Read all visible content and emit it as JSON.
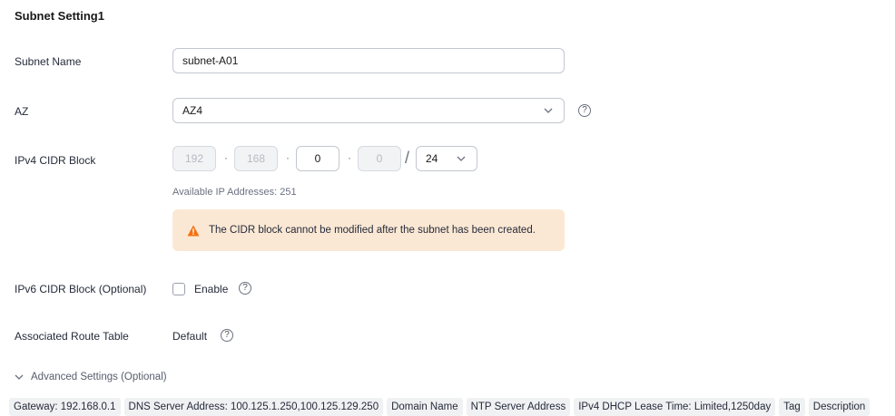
{
  "section": {
    "title": "Subnet Setting1"
  },
  "subnet_name": {
    "label": "Subnet Name",
    "value": "subnet-A01"
  },
  "az": {
    "label": "AZ",
    "value": "AZ4"
  },
  "ipv4": {
    "label": "IPv4 CIDR Block",
    "octets": [
      "192",
      "168",
      "0",
      "0"
    ],
    "mask": "24",
    "available": "Available IP Addresses: 251",
    "warning": "The CIDR block cannot be modified after the subnet has been created."
  },
  "ipv6": {
    "label": "IPv6 CIDR Block (Optional)",
    "enable_label": "Enable"
  },
  "route_table": {
    "label": "Associated Route Table",
    "value": "Default"
  },
  "advanced": {
    "label": "Advanced Settings (Optional)",
    "tags": [
      "Gateway: 192.168.0.1",
      "DNS Server Address: 100.125.1.250,100.125.129.250",
      "Domain Name",
      "NTP Server Address",
      "IPv4 DHCP Lease Time: Limited,1250day",
      "Tag",
      "Description"
    ]
  },
  "colors": {
    "warning_bg": "#fbe8d4",
    "warning_icon": "#f66f0f",
    "disabled_bg": "#f2f3f5"
  },
  "icons": {
    "help": "question-circle-icon",
    "warning": "warning-triangle-icon",
    "dropdown": "chevron-down-icon"
  }
}
